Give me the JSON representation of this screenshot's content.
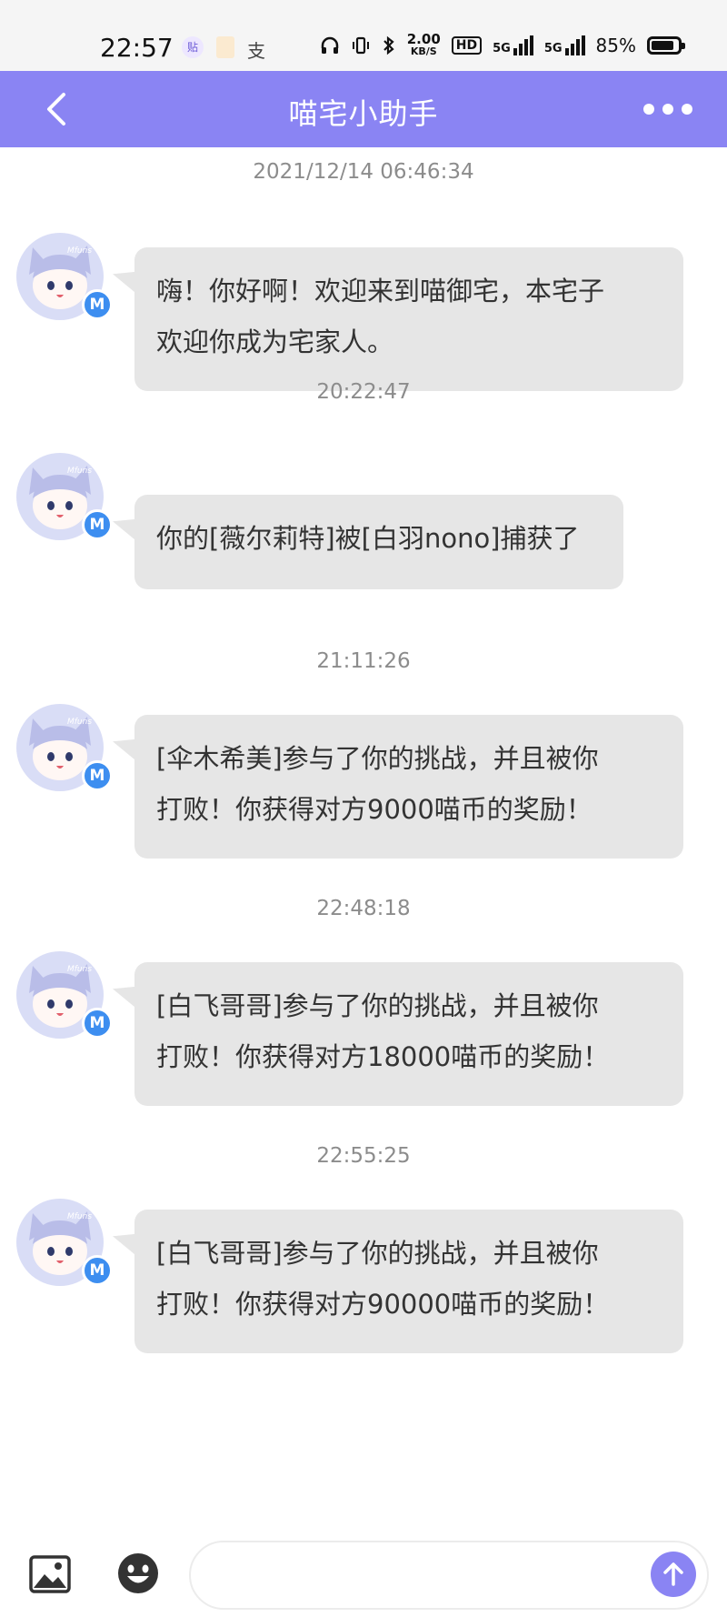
{
  "status_bar": {
    "time": "22:57",
    "app_icons": [
      "贴",
      "",
      "支"
    ],
    "net_speed_value": "2.00",
    "net_speed_unit": "KB/S",
    "hd": "HD",
    "sim1": "5G",
    "sim2": "5G",
    "battery_percent_text": "85%",
    "battery_level": 0.85
  },
  "header": {
    "title": "喵宅小助手"
  },
  "messages": [
    {
      "time": "2021/12/14 06:46:34",
      "lines": [
        "嗨！你好啊！欢迎来到喵御宅，本宅子",
        "欢迎你成为宅家人。"
      ]
    },
    {
      "time": "20:22:47",
      "lines": [
        "你的[薇尔莉特]被[白羽nono]捕获了"
      ]
    },
    {
      "time": "21:11:26",
      "lines": [
        "[伞木希美]参与了你的挑战，并且被你",
        "打败！你获得对方9000喵币的奖励！"
      ]
    },
    {
      "time": "22:48:18",
      "lines": [
        "[白飞哥哥]参与了你的挑战，并且被你",
        "打败！你获得对方18000喵币的奖励！"
      ]
    },
    {
      "time": "22:55:25",
      "lines": [
        "[白飞哥哥]参与了你的挑战，并且被你",
        "打败！你获得对方90000喵币的奖励！"
      ]
    }
  ],
  "avatar": {
    "badge": "M",
    "caption": "Mfuns"
  },
  "input": {
    "placeholder": "",
    "value": ""
  },
  "colors": {
    "accent": "#8a84f3",
    "bubble": "#e6e6e6",
    "badge": "#3d8ef0"
  }
}
